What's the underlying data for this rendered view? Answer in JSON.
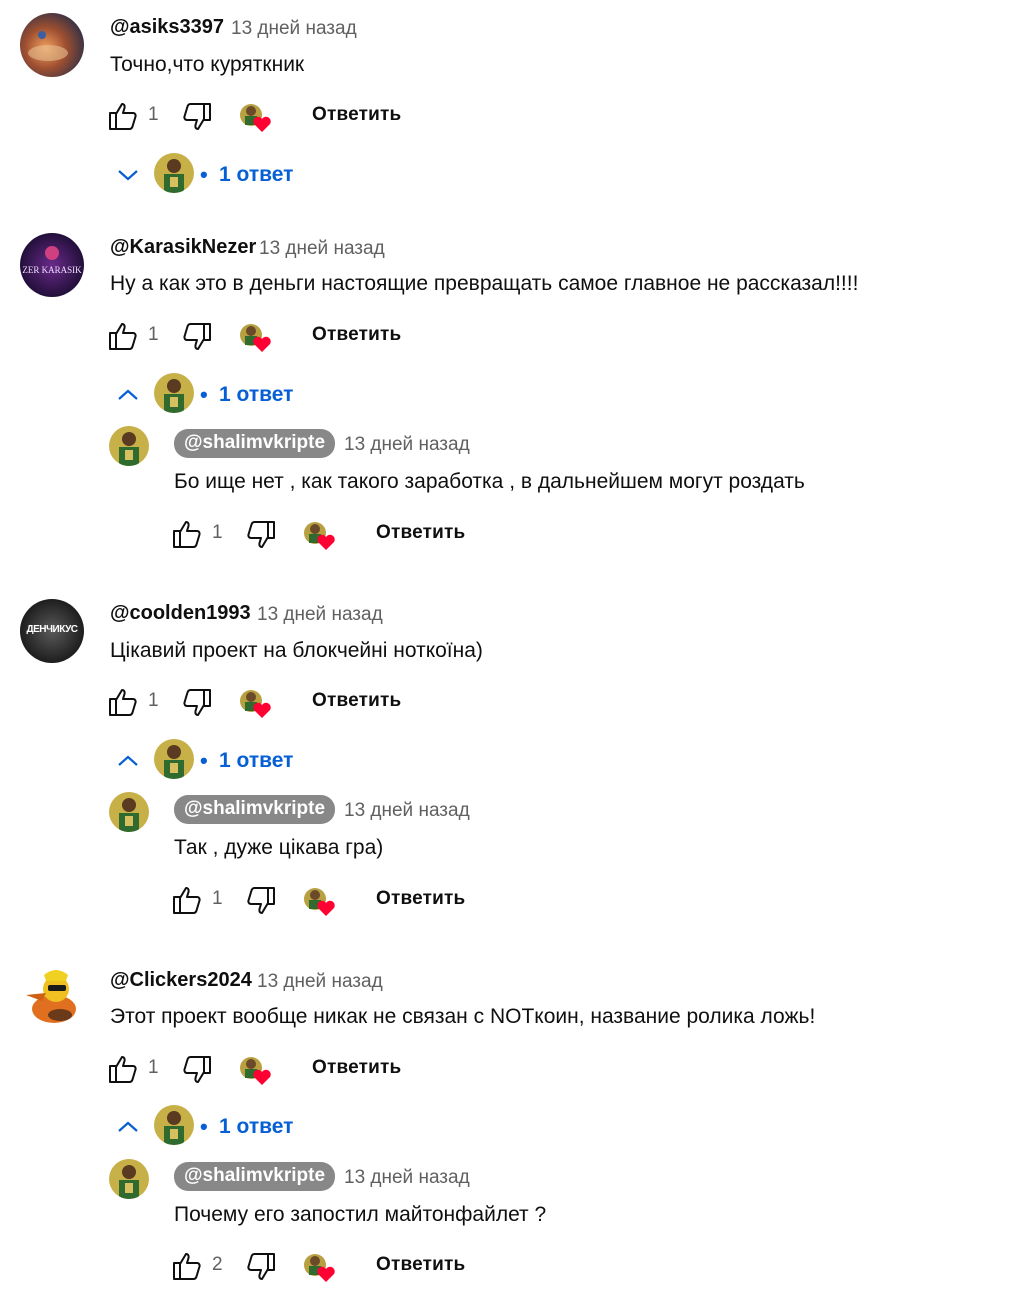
{
  "labels": {
    "reply": "Ответить",
    "replies_count": "1 ответ",
    "bullet": "•"
  },
  "comments": [
    {
      "author": "@asiks3397",
      "time": "13 дней назад",
      "text": "Точно,что куряткник",
      "likes": "1",
      "replies_expanded": false
    },
    {
      "author": "@KarasikNezer",
      "time": "13 дней назад",
      "text": "Ну а как это в деньги настоящие превращать самое главное не рассказал!!!!",
      "likes": "1",
      "avatar_text": "ZER KARASIK",
      "replies_expanded": true,
      "reply": {
        "author": "@shalimvkripte",
        "time": "13 дней назад",
        "text": "Бо ище нет , как такого заработка , в дальнейшем могут роздать",
        "likes": "1"
      }
    },
    {
      "author": "@coolden1993",
      "time": "13 дней назад",
      "text": "Цікавий проект на блокчейні ноткоїна)",
      "likes": "1",
      "avatar_text": "ДЕНЧИКУС",
      "replies_expanded": true,
      "reply": {
        "author": "@shalimvkripte",
        "time": "13 дней назад",
        "text": "Так , дуже цікава гра)",
        "likes": "1"
      }
    },
    {
      "author": "@Clickers2024",
      "time": "13 дней назад",
      "text": "Этот проект вообще никак не связан с NOTкоин, название ролика ложь!",
      "likes": "1",
      "replies_expanded": true,
      "reply": {
        "author": "@shalimvkripte",
        "time": "13 дней назад",
        "text": "Почему его запостил майтонфайлет ?",
        "likes": "2"
      }
    }
  ],
  "colors": {
    "link_blue": "#065fd4",
    "heart_red": "#ff0033",
    "secondary_text": "#606060",
    "chip_gray": "#888888"
  }
}
